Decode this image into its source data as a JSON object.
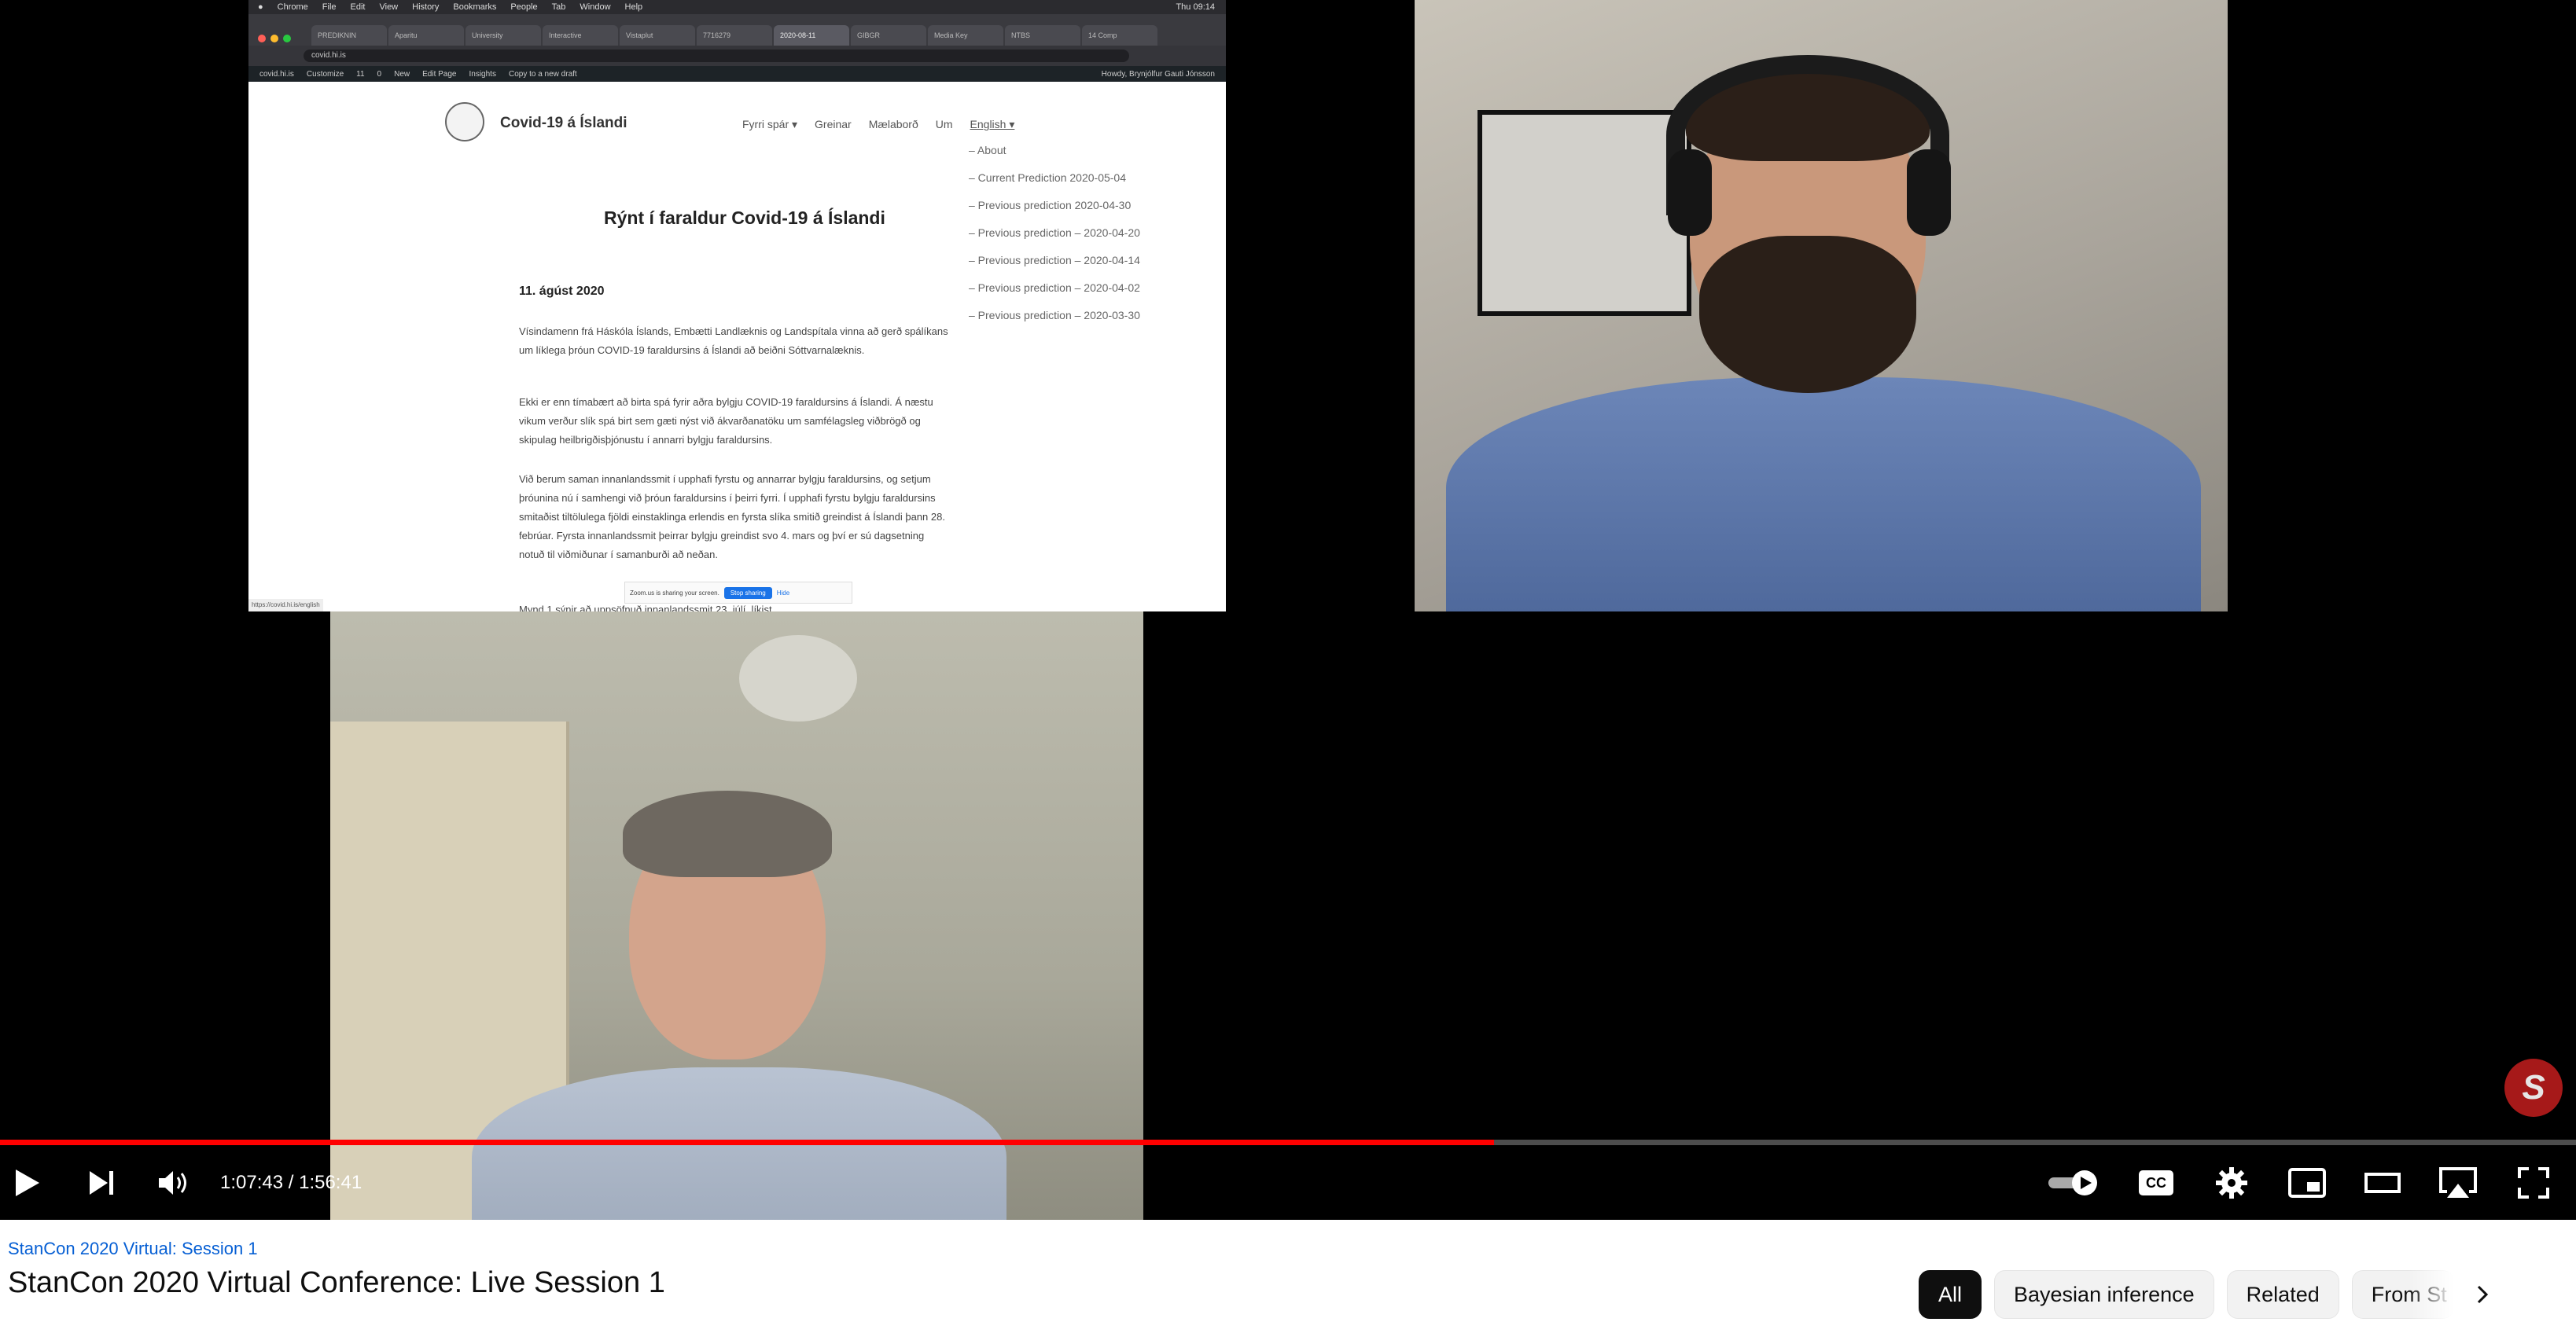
{
  "screen_share": {
    "menubar": [
      "Chrome",
      "File",
      "Edit",
      "View",
      "History",
      "Bookmarks",
      "People",
      "Tab",
      "Window",
      "Help"
    ],
    "menubar_right": "Thu 09:14",
    "tabs": [
      "PREDIKNIN",
      "Aparitu",
      "University",
      "Interactive",
      "Vistaplut",
      "7716279",
      "2020-08-11",
      "GIBGR",
      "Media Key",
      "NTBS",
      "14 Comp"
    ],
    "url": "covid.hi.is",
    "wp_admin_items": [
      "covid.hi.is",
      "Customize",
      "11",
      "0",
      "New",
      "Edit Page",
      "Insights",
      "Copy to a new draft"
    ],
    "wp_admin_right": "Howdy, Brynjólfur Gauti Jónsson",
    "site_title": "Covid-19 á Íslandi",
    "nav": [
      "Fyrri spár ▾",
      "Greinar",
      "Mælaborð",
      "Um",
      "English ▾"
    ],
    "dropdown": [
      "– About",
      "– Current Prediction 2020-05-04",
      "– Previous prediction 2020-04-30",
      "– Previous prediction – 2020-04-20",
      "– Previous prediction – 2020-04-14",
      "– Previous prediction – 2020-04-02",
      "– Previous prediction – 2020-03-30"
    ],
    "heading": "Rýnt í faraldur Covid-19 á Íslandi",
    "date": "11. ágúst 2020",
    "paragraphs": [
      "Vísindamenn frá Háskóla Íslands, Embætti Landlæknis og Landspítala vinna að gerð spálíkans um líklega þróun COVID-19 faraldursins á Íslandi að beiðni Sóttvarnalæknis.",
      "Ekki er enn tímabært að birta spá fyrir aðra bylgju COVID-19 faraldursins á Íslandi. Á næstu vikum verður slík spá birt sem gæti nýst við ákvarðanatöku um samfélagsleg viðbrögð og skipulag heilbrigðisþjónustu í annarri bylgju faraldursins.",
      "Við berum saman innanlandssmit í upphafi fyrstu og annarrar bylgju faraldursins, og setjum þróunina nú í samhengi við þróun faraldursins í þeirri fyrri. Í upphafi fyrstu bylgju faraldursins smitaðist tiltölulega fjöldi einstaklinga erlendis en fyrsta slíka smitið greindist á Íslandi þann 28. febrúar. Fyrsta innanlandssmit þeirrar bylgju greindist svo 4. mars og því er sú dagsetning notuð til viðmiðunar í samanburði að neðan.",
      "Mynd 1 sýnir að uppsöfnuð innanlandssmit 23. júlí, líkist"
    ],
    "sharing_text": "Zoom.us is sharing your screen.",
    "stop_label": "Stop sharing",
    "hide_label": "Hide",
    "url_tooltip": "https://covid.hi.is/english"
  },
  "player": {
    "badge_letter": "S",
    "time_current": "1:07:43",
    "time_total": "1:56:41",
    "progress_fraction": 0.58,
    "cc_label": "CC",
    "accent": "#ff0000"
  },
  "below": {
    "series_link": "StanCon 2020 Virtual: Session 1",
    "title": "StanCon 2020 Virtual Conference: Live Session 1",
    "chips": [
      "All",
      "Bayesian inference",
      "Related",
      "From St"
    ],
    "next_icon": "chevron-right-icon"
  }
}
